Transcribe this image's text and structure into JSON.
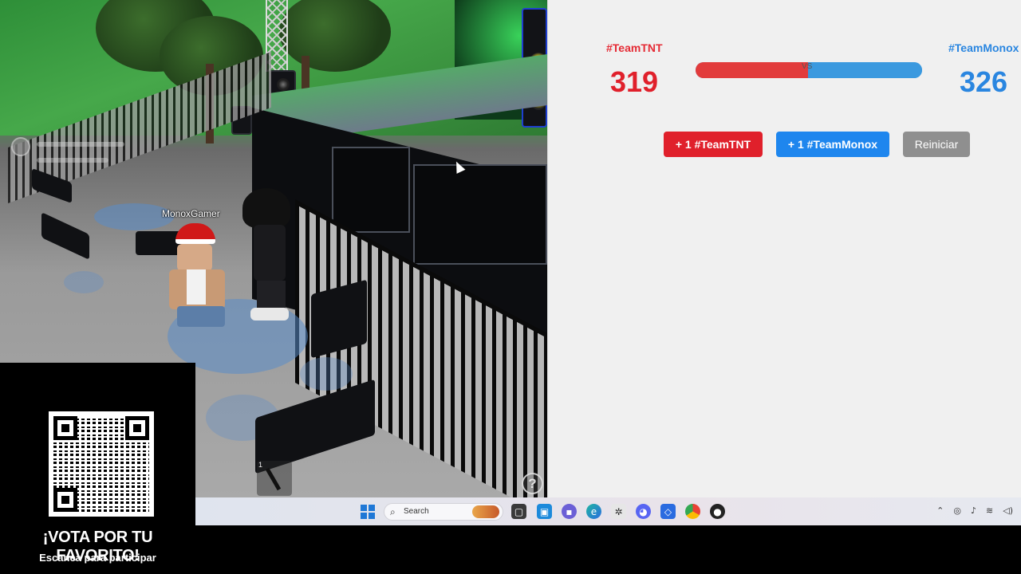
{
  "game": {
    "player_name": "MonoxGamer",
    "hotbar_slot_number": "1",
    "help_label": "?"
  },
  "vote": {
    "team_a": {
      "label": "#TeamTNT",
      "score": "319",
      "button_label": "+ 1 #TeamTNT",
      "color": "#e0202b"
    },
    "team_b": {
      "label": "#TeamMonox",
      "score": "326",
      "button_label": "+ 1 #TeamMonox",
      "color": "#1e86ee"
    },
    "vs_label": "VS",
    "progress_fraction_team_a": 0.495,
    "reset_label": "Reiniciar"
  },
  "taskbar": {
    "search_placeholder": "Search",
    "icons": [
      "windows-start-icon",
      "search-icon",
      "task-view-icon",
      "file-explorer-icon",
      "store-icon",
      "chat-icon",
      "edge-icon",
      "settings-icon",
      "discord-icon",
      "roblox-icon",
      "chrome-icon",
      "media-icon"
    ],
    "tray_icons": [
      "chevron-up-icon",
      "network-icon",
      "microphone-icon",
      "wifi-icon",
      "volume-icon"
    ]
  },
  "overlay": {
    "title": "¡VOTA POR TU FAVORITO!",
    "subtitle": "Escanea para participar"
  }
}
